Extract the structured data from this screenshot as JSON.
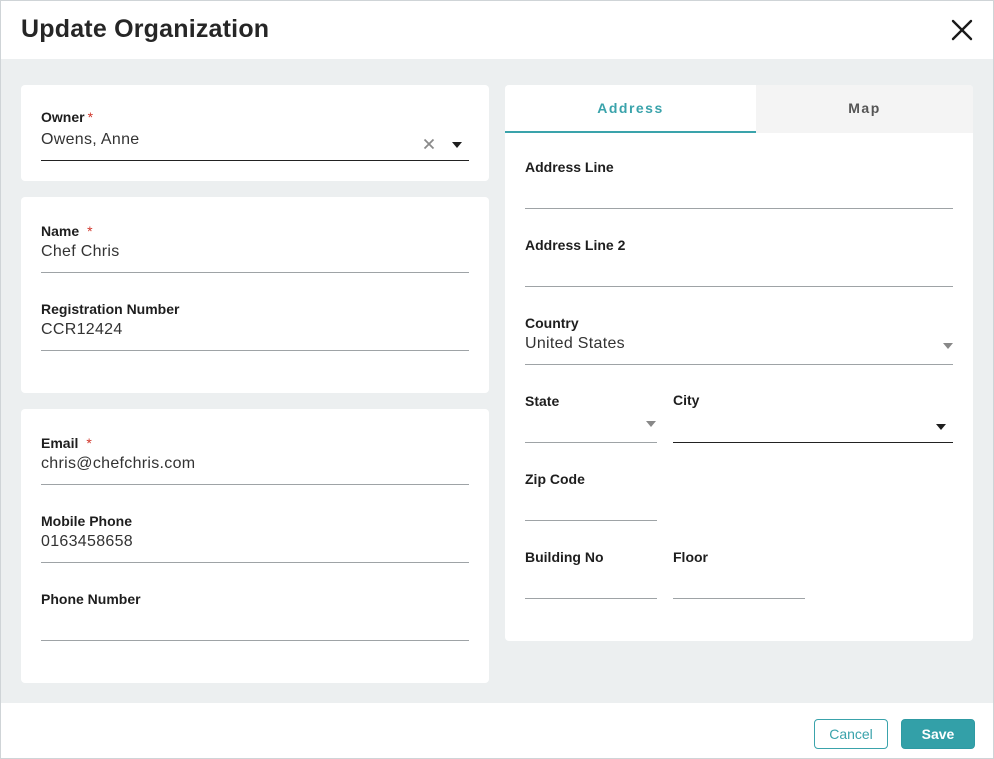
{
  "dialog": {
    "title": "Update Organization",
    "close_icon": "close-icon"
  },
  "owner": {
    "label": "Owner",
    "required": "*",
    "value": "Owens, Anne"
  },
  "identity": {
    "name_label": "Name",
    "name_required": "*",
    "name_value": "Chef Chris",
    "registration_label": "Registration Number",
    "registration_value": "CCR12424"
  },
  "contact": {
    "email_label": "Email",
    "email_required": "*",
    "email_value": "chris@chefchris.com",
    "mobile_label": "Mobile Phone",
    "mobile_value": "0163458658",
    "phone_label": "Phone Number",
    "phone_value": ""
  },
  "address": {
    "tabs": [
      {
        "label": "Address",
        "active": true
      },
      {
        "label": "Map",
        "active": false
      }
    ],
    "line1_label": "Address Line",
    "line1_value": "",
    "line2_label": "Address Line 2",
    "line2_value": "",
    "country_label": "Country",
    "country_value": "United States",
    "state_label": "State",
    "state_value": "",
    "city_label": "City",
    "city_value": "",
    "zip_label": "Zip Code",
    "zip_value": "",
    "building_label": "Building No",
    "building_value": "",
    "floor_label": "Floor",
    "floor_value": ""
  },
  "footer": {
    "cancel_label": "Cancel",
    "save_label": "Save"
  },
  "colors": {
    "accent": "#3aa3ab",
    "required": "#d0352a",
    "panel_bg": "#eceff0"
  }
}
